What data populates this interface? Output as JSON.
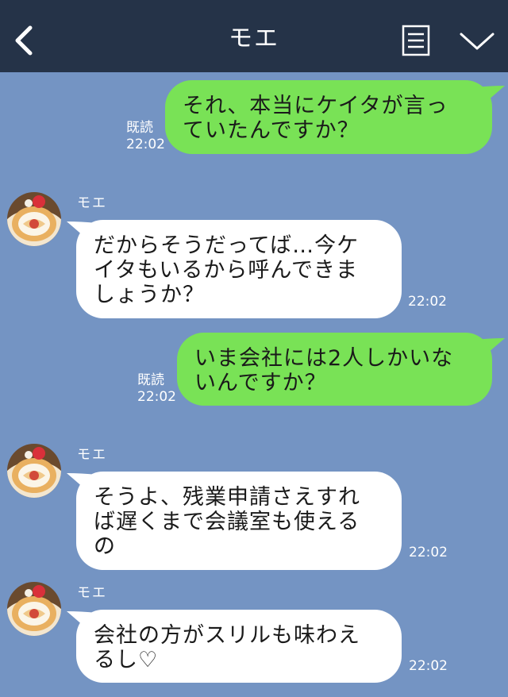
{
  "header": {
    "title": "モエ"
  },
  "messages": [
    {
      "side": "me",
      "text": "それ、本当にケイタが言っ\nていたんですか？",
      "read_label": "既読",
      "time": "22:02"
    },
    {
      "side": "them",
      "sender": "モエ",
      "text": "だからそうだってば…今ケ\nイタもいるから呼んできま\nしょうか？",
      "time": "22:02"
    },
    {
      "side": "me",
      "text": "いま会社には2人しかいな\nいんですか？",
      "read_label": "既読",
      "time": "22:02"
    },
    {
      "side": "them",
      "sender": "モエ",
      "text": "そうよ、残業申請さえすれ\nば遅くまで会議室も使える\nの",
      "time": "22:02"
    },
    {
      "side": "them",
      "sender": "モエ",
      "text": "会社の方がスリルも味わえ\nるし♡",
      "time": "22:02"
    }
  ],
  "colors": {
    "header_bg": "#253348",
    "chat_bg": "#7494c3",
    "my_bubble": "#79e256",
    "their_bubble": "#ffffff"
  },
  "icons": {
    "back": "chevron-left-icon",
    "notes": "notes-icon",
    "menu": "chevron-down-icon",
    "avatar": "roll-cake-avatar"
  }
}
